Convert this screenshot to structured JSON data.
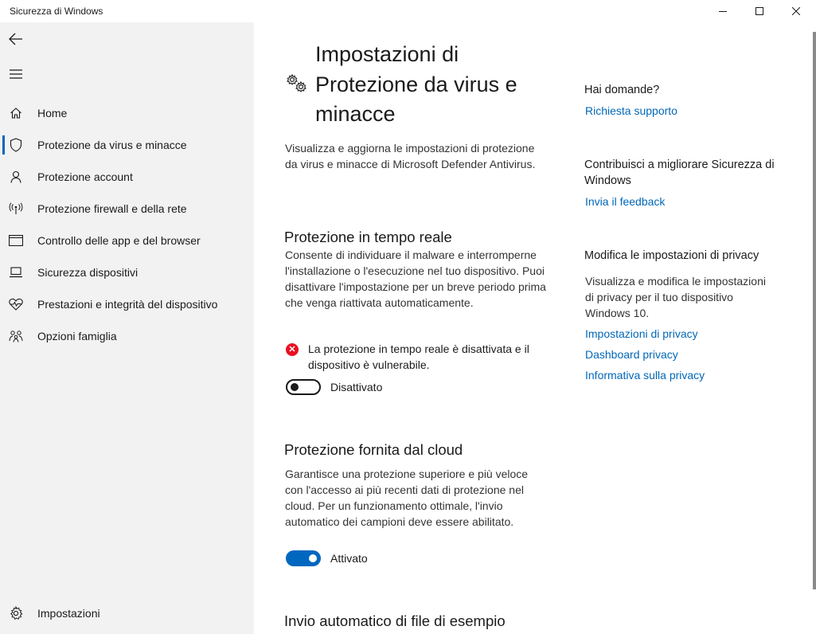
{
  "window": {
    "title": "Sicurezza di Windows",
    "minimize_icon": "minimize-icon",
    "maximize_icon": "maximize-icon",
    "close_icon": "close-icon"
  },
  "sidebar": {
    "back_icon": "back-arrow-icon",
    "menu_icon": "hamburger-menu-icon",
    "items": [
      {
        "label": "Home",
        "icon": "home-icon"
      },
      {
        "label": "Protezione da virus e minacce",
        "icon": "shield-icon",
        "selected": true
      },
      {
        "label": "Protezione account",
        "icon": "person-icon"
      },
      {
        "label": "Protezione firewall e della rete",
        "icon": "antenna-icon"
      },
      {
        "label": "Controllo delle app e del browser",
        "icon": "app-window-icon"
      },
      {
        "label": "Sicurezza dispositivi",
        "icon": "laptop-icon"
      },
      {
        "label": "Prestazioni e integrità del dispositivo",
        "icon": "heart-pulse-icon"
      },
      {
        "label": "Opzioni famiglia",
        "icon": "family-icon"
      }
    ],
    "settings": {
      "label": "Impostazioni",
      "icon": "gear-icon"
    }
  },
  "main": {
    "title": "Impostazioni di Protezione da virus e minacce",
    "title_icon": "gears-icon",
    "description": "Visualizza e aggiorna le impostazioni di protezione da virus e minacce di Microsoft Defender Antivirus.",
    "realtime": {
      "title": "Protezione in tempo reale",
      "description": "Consente di individuare il malware e interromperne l'installazione o l'esecuzione nel tuo dispositivo. Puoi disattivare l'impostazione per un breve periodo prima che venga riattivata automaticamente.",
      "warning": "La protezione in tempo reale è disattivata e il dispositivo è vulnerabile.",
      "warning_icon": "error-x-icon",
      "toggle_state": "off",
      "toggle_label": "Disattivato"
    },
    "cloud": {
      "title": "Protezione fornita dal cloud",
      "description": "Garantisce una protezione superiore e più veloce con l'accesso ai più recenti dati di protezione nel cloud. Per un funzionamento ottimale, l'invio automatico dei campioni deve essere abilitato.",
      "toggle_state": "on",
      "toggle_label": "Attivato"
    },
    "sample": {
      "title": "Invio automatico di file di esempio"
    }
  },
  "aside": {
    "questions_heading": "Hai domande?",
    "support_link": "Richiesta supporto",
    "improve_heading": "Contribuisci a migliorare Sicurezza di Windows",
    "feedback_link": "Invia il feedback",
    "privacy_heading": "Modifica le impostazioni di privacy",
    "privacy_text": "Visualizza e modifica le impostazioni di privacy per il tuo dispositivo Windows 10.",
    "privacy_links": [
      "Impostazioni di privacy",
      "Dashboard privacy",
      "Informativa sulla privacy"
    ]
  },
  "colors": {
    "accent": "#0067b8",
    "toggle_on": "#0067c0",
    "error": "#e81123",
    "sidebar_bg": "#f2f2f2"
  }
}
